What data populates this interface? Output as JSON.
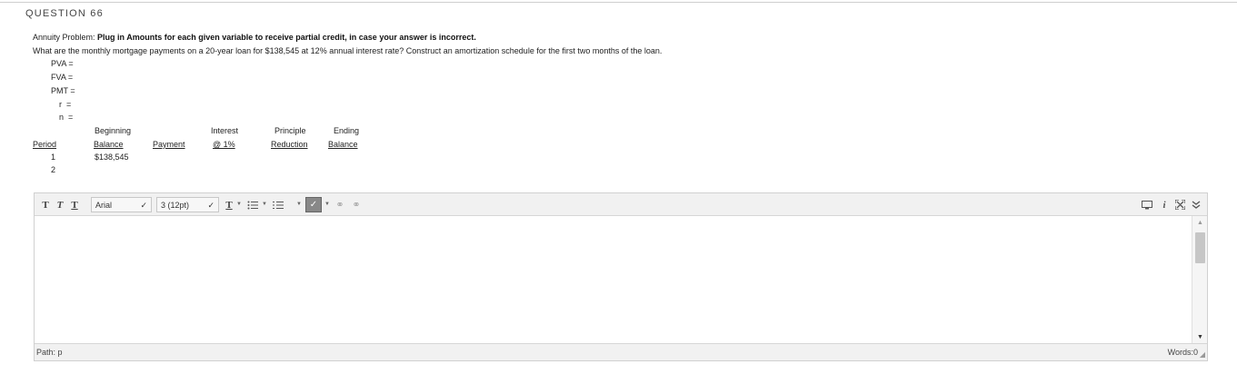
{
  "question": {
    "title": "QUESTION 66",
    "prefix": "Annuity Problem: ",
    "instruction_bold": "Plug in Amounts for each given variable to receive partial credit, in case your answer is incorrect.",
    "text": "What are the monthly mortgage payments on a 20-year loan for $138,545 at 12% annual interest rate?  Construct an amortization schedule for the first two months of the loan.",
    "variables": [
      "PVA =",
      "FVA =",
      "PMT =",
      "r  =",
      "n  ="
    ]
  },
  "table": {
    "headers": {
      "period": "Period",
      "beginning_top": "Beginning",
      "beginning_bottom": "Balance",
      "payment": "Payment",
      "interest_top": "Interest",
      "interest_bottom": "@ 1%",
      "principle_top": "Principle",
      "principle_bottom": "Reduction",
      "ending_top": "Ending",
      "ending_bottom": "Balance"
    },
    "rows": [
      {
        "period": "1",
        "beginning_balance": "$138,545"
      },
      {
        "period": "2",
        "beginning_balance": ""
      }
    ]
  },
  "editor": {
    "font_family": "Arial",
    "font_size": "3 (12pt)",
    "path_label": "Path: p",
    "words_label": "Words:0"
  },
  "icons": [
    "bold-t-icon",
    "italic-t-icon",
    "underline-t-icon",
    "text-color-icon",
    "bullet-list-icon",
    "numbered-list-icon",
    "spellcheck-icon",
    "link-icon",
    "unlink-icon",
    "preview-icon",
    "info-icon",
    "fullscreen-icon",
    "collapse-icon"
  ]
}
